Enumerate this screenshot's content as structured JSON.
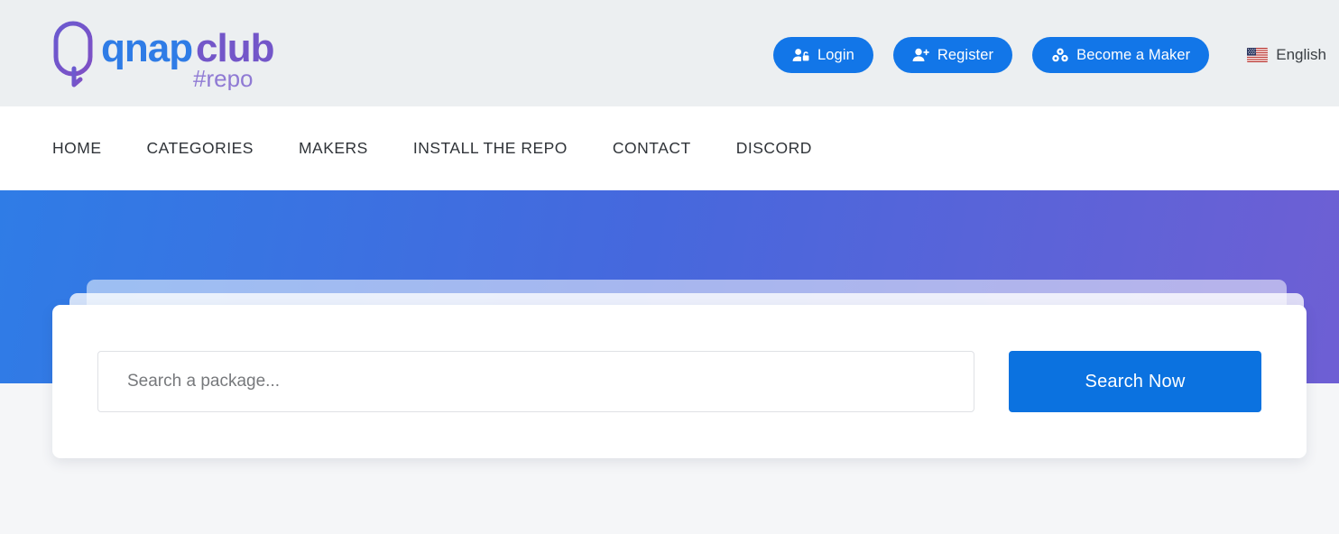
{
  "brand": {
    "name_part1": "qnap",
    "name_part2": "club",
    "tagline": "#repo",
    "mark_icon": "qnap-q-icon",
    "color_blue": "#2f7ce6",
    "color_purple": "#7356c9"
  },
  "topbar": {
    "background": "#eceff1",
    "buttons": [
      {
        "label": "Login",
        "icon": "user-lock-icon",
        "color": "#1276e8"
      },
      {
        "label": "Register",
        "icon": "user-plus-icon",
        "color": "#1276e8"
      },
      {
        "label": "Become a Maker",
        "icon": "cubes-icon",
        "color": "#1276e8"
      }
    ],
    "language": {
      "label": "English",
      "icon": "us-flag-icon"
    }
  },
  "nav": {
    "items": [
      {
        "label": "HOME"
      },
      {
        "label": "CATEGORIES"
      },
      {
        "label": "MAKERS"
      },
      {
        "label": "INSTALL THE REPO"
      },
      {
        "label": "CONTACT"
      },
      {
        "label": "DISCORD"
      }
    ]
  },
  "hero": {
    "gradient_from": "#2f7ce6",
    "gradient_mid": "#4668dd",
    "gradient_to": "#6e5fd4"
  },
  "search": {
    "placeholder": "Search a package...",
    "value": "",
    "button_label": "Search Now",
    "button_color": "#0b72e0"
  }
}
